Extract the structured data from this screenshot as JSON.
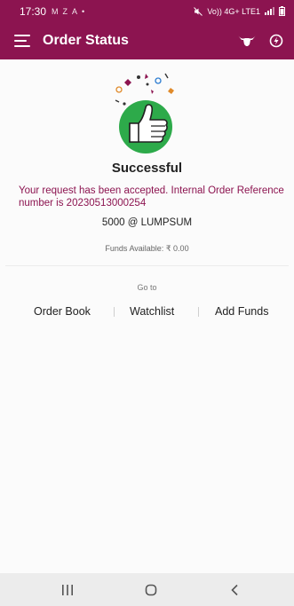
{
  "status_bar": {
    "time": "17:30",
    "notification_icons": [
      "M",
      "Z",
      "A",
      "•"
    ],
    "network_text": "Vo)) 4G+ LTE1"
  },
  "app_bar": {
    "title": "Order Status",
    "background_color": "#8c1450"
  },
  "result": {
    "heading": "Successful",
    "message": "Your request has been accepted. Internal Order Reference number is 20230513000254",
    "amount_line": "5000 @ LUMPSUM",
    "funds_label": "Funds Available:",
    "funds_value": "₹ 0.00",
    "illustration_icon": "thumbs-up-icon",
    "accent_color": "#2daa4a"
  },
  "goto": {
    "label": "Go to",
    "links": [
      {
        "label": "Order Book"
      },
      {
        "label": "Watchlist"
      },
      {
        "label": "Add Funds"
      }
    ]
  },
  "system_nav": {
    "icons": [
      "recent-apps-icon",
      "home-icon",
      "back-icon"
    ]
  }
}
